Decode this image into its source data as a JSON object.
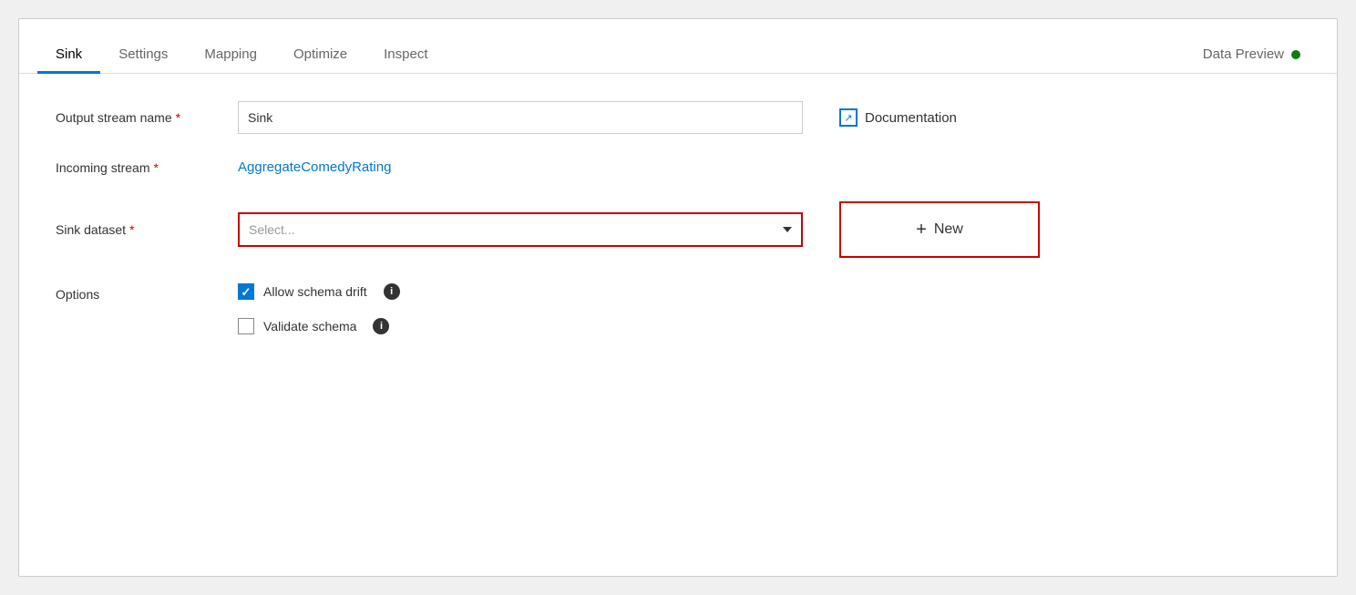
{
  "tabs": [
    {
      "id": "sink",
      "label": "Sink",
      "active": true
    },
    {
      "id": "settings",
      "label": "Settings",
      "active": false
    },
    {
      "id": "mapping",
      "label": "Mapping",
      "active": false
    },
    {
      "id": "optimize",
      "label": "Optimize",
      "active": false
    },
    {
      "id": "inspect",
      "label": "Inspect",
      "active": false
    },
    {
      "id": "data-preview",
      "label": "Data Preview",
      "active": false
    }
  ],
  "form": {
    "output_stream_name_label": "Output stream name",
    "output_stream_name_value": "Sink",
    "incoming_stream_label": "Incoming stream",
    "incoming_stream_value": "AggregateComedyRating",
    "sink_dataset_label": "Sink dataset",
    "sink_dataset_placeholder": "Select...",
    "options_label": "Options",
    "allow_schema_drift_label": "Allow schema drift",
    "allow_schema_drift_checked": true,
    "validate_schema_label": "Validate schema",
    "validate_schema_checked": false
  },
  "buttons": {
    "new_label": "New",
    "documentation_label": "Documentation"
  },
  "icons": {
    "plus": "+",
    "checkmark": "✓",
    "info": "i",
    "status_dot_color": "#107c10"
  }
}
